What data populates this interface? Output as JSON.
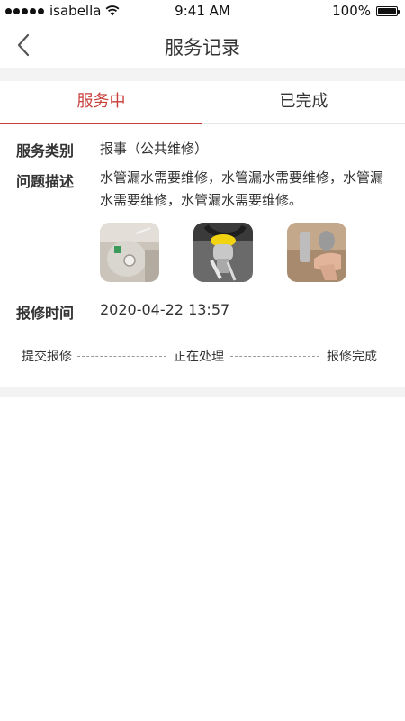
{
  "status_bar": {
    "carrier": "isabella",
    "time": "9:41 AM",
    "battery": "100%",
    "battery_level": 1.0
  },
  "nav": {
    "title": "服务记录",
    "back_icon": "chevron-left-icon"
  },
  "tabs": [
    {
      "label": "服务中",
      "active": true
    },
    {
      "label": "已完成",
      "active": false
    }
  ],
  "record": {
    "category_label": "服务类别",
    "category_value": "报事（公共维修）",
    "description_label": "问题描述",
    "description_value": "水管漏水需要维修，水管漏水需要维修，水管漏水需要维修，水管漏水需要维修。",
    "time_label": "报修时间",
    "time_value": "2020-04-22 13:57"
  },
  "progress_steps": [
    "提交报修",
    "正在处理",
    "报修完成"
  ],
  "colors": {
    "accent": "#c8403c",
    "divider_bg": "#f3f3f3"
  }
}
